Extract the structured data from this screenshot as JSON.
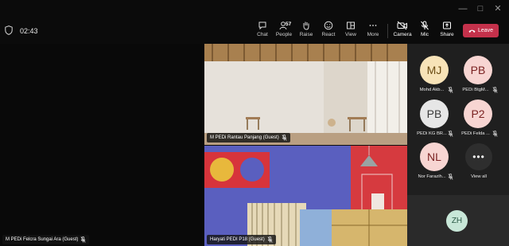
{
  "meeting": {
    "timer": "02:43"
  },
  "toolbar": {
    "chat_label": "Chat",
    "people_label": "People",
    "people_count": "57",
    "raise_label": "Raise",
    "react_label": "React",
    "view_label": "View",
    "more_label": "More",
    "camera_label": "Camera",
    "mic_label": "Mic",
    "share_label": "Share",
    "leave_label": "Leave"
  },
  "tiles": {
    "left_name": "M PEDi Felcra Sungai Ara (Guest)",
    "top_right_name": "M PEDi Rantau Panjang (Guest)",
    "bottom_right_name": "Haryati PEDI P18 (Guest)"
  },
  "roster": {
    "participants": [
      {
        "initials": "MJ",
        "label": "Mohd Akb...",
        "bg": "#f7e3b8",
        "fg": "#6b4b12"
      },
      {
        "initials": "PB",
        "label": "PEDi BtgM...",
        "bg": "#f7d5d2",
        "fg": "#7a2222"
      },
      {
        "initials": "PB",
        "label": "PEDi KG BR...",
        "bg": "#e6e6e6",
        "fg": "#3a3a3a"
      },
      {
        "initials": "P2",
        "label": "PEDi Felda ...",
        "bg": "#f7d5d2",
        "fg": "#7a2222"
      },
      {
        "initials": "NL",
        "label": "Nor Farazih...",
        "bg": "#f7d5d2",
        "fg": "#7a2222"
      }
    ],
    "view_all_label": "View all",
    "bottom_initials": "ZH"
  },
  "colors": {
    "leave": "#c4314b",
    "roster_bg": "#1f1f1f"
  }
}
